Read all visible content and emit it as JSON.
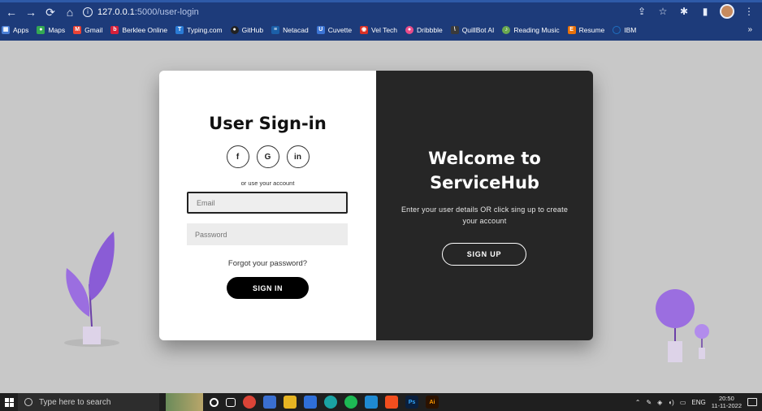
{
  "browser": {
    "host": "127.0.0.1",
    "path": ":5000/user-login",
    "bookmarks": [
      {
        "label": "Apps",
        "icon": "apps-icon",
        "color": "#4a7fd6"
      },
      {
        "label": "Maps",
        "icon": "maps-icon",
        "color": "#34a853"
      },
      {
        "label": "Gmail",
        "icon": "gmail-icon",
        "color": "#ea4335"
      },
      {
        "label": "Berklee Online",
        "icon": "berklee-icon",
        "color": "#d6203b"
      },
      {
        "label": "Typing.com",
        "icon": "typing-icon",
        "color": "#2a7bd5"
      },
      {
        "label": "GitHub",
        "icon": "github-icon",
        "color": "#222222"
      },
      {
        "label": "Netacad",
        "icon": "netacad-icon",
        "color": "#1b5fa8"
      },
      {
        "label": "Cuvette",
        "icon": "cuvette-icon",
        "color": "#3c74d4"
      },
      {
        "label": "Vel Tech",
        "icon": "veltech-icon",
        "color": "#d93025"
      },
      {
        "label": "Dribbble",
        "icon": "dribbble-icon",
        "color": "#ea4c89"
      },
      {
        "label": "QuillBot AI",
        "icon": "quillbot-icon",
        "color": "#3a3a3a"
      },
      {
        "label": "Reading Music",
        "icon": "reading-music-icon",
        "color": "#6aa84f"
      },
      {
        "label": "Resume",
        "icon": "resume-icon",
        "color": "#e8710a"
      },
      {
        "label": "IBM",
        "icon": "ibm-icon",
        "color": "#1f70c1"
      }
    ],
    "more": "»"
  },
  "signin": {
    "title": "User Sign-in",
    "socials": [
      "f",
      "G",
      "in"
    ],
    "alt_text": "or use your account",
    "email_placeholder": "Email",
    "password_placeholder": "Password",
    "forgot": "Forgot your password?",
    "button": "SIGN IN"
  },
  "signup": {
    "title_line1": "Welcome to",
    "title_line2": "ServiceHub",
    "subtitle": "Enter your user details OR click sing up to create your account",
    "button": "SIGN UP"
  },
  "taskbar": {
    "search_placeholder": "Type here to search",
    "language": "ENG",
    "time": "20:50",
    "date": "11-11-2022",
    "apps": [
      {
        "name": "task-view-icon",
        "label": "",
        "color": "#1f1f1f"
      },
      {
        "name": "chrome-icon",
        "label": "",
        "color": "#db4437"
      },
      {
        "name": "store-icon",
        "label": "",
        "color": "#3a6fd0"
      },
      {
        "name": "file-explorer-icon",
        "label": "",
        "color": "#e6b422"
      },
      {
        "name": "mail-icon",
        "label": "",
        "color": "#2f6fd8"
      },
      {
        "name": "edge-icon",
        "label": "",
        "color": "#1aa3a3"
      },
      {
        "name": "spotify-icon",
        "label": "",
        "color": "#1db954"
      },
      {
        "name": "vscode-icon",
        "label": "",
        "color": "#1f8ad2"
      },
      {
        "name": "figma-icon",
        "label": "",
        "color": "#f24e1e"
      },
      {
        "name": "photoshop-icon",
        "label": "Ps",
        "color": "#0a1f3d"
      },
      {
        "name": "illustrator-icon",
        "label": "Ai",
        "color": "#2b1200"
      }
    ]
  }
}
